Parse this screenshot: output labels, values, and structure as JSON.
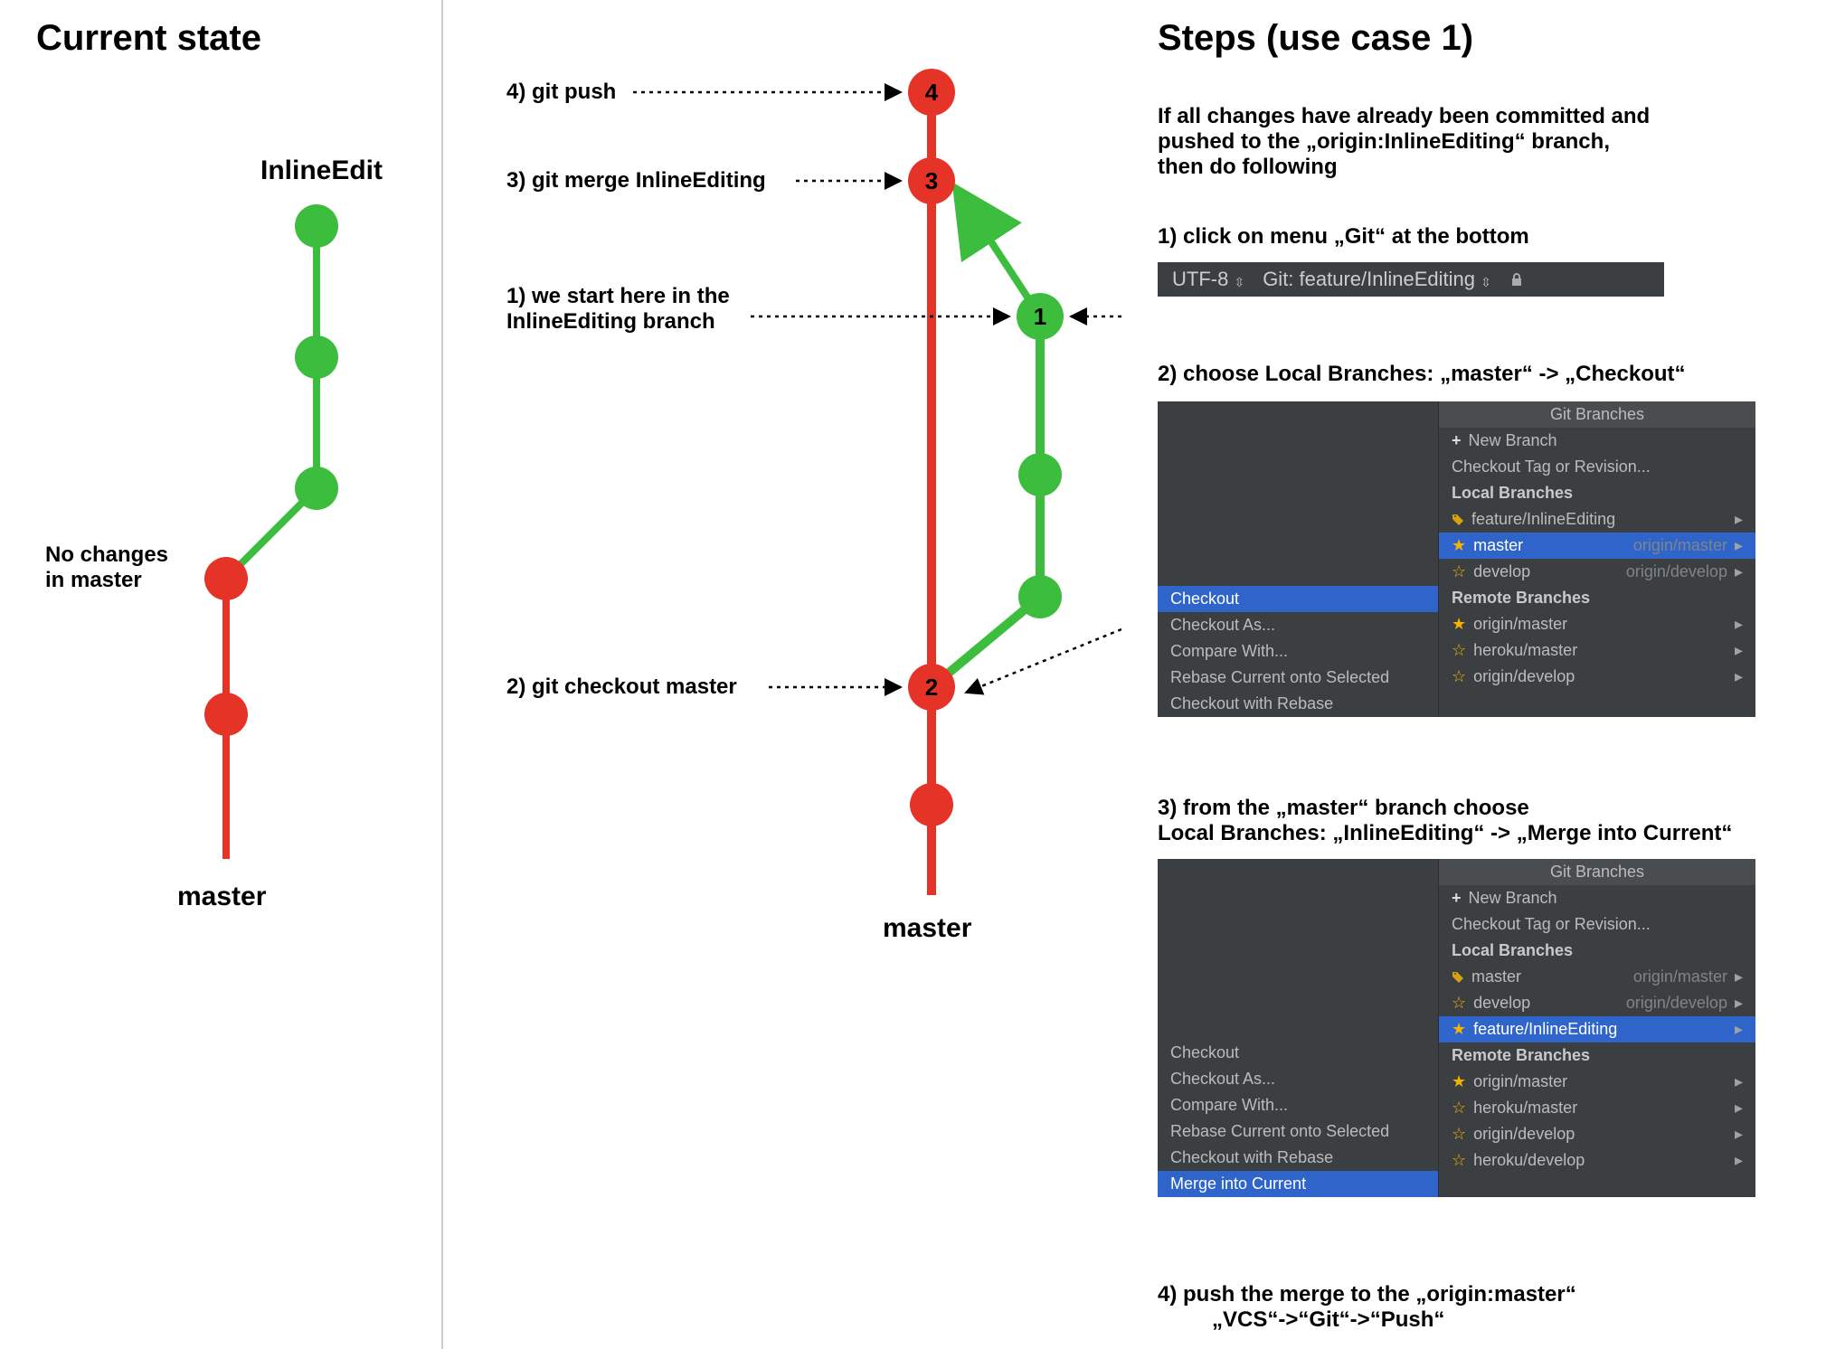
{
  "colors": {
    "red": "#e53427",
    "green": "#3dbd3d",
    "panel": "#3c3f41",
    "sel": "#2f65ca"
  },
  "left": {
    "title": "Current state",
    "feature_label": "InlineEdit",
    "no_changes_l1": "No changes",
    "no_changes_l2": "in master",
    "master_label": "master"
  },
  "mid": {
    "step4": "4) git push",
    "step3": "3) git merge InlineEditing",
    "step1_l1": "1) we start here in the",
    "step1_l2": "InlineEditing branch",
    "step2": "2) git checkout master",
    "master_label": "master",
    "commit4": "4",
    "commit3": "3",
    "commit2": "2",
    "commit1": "1"
  },
  "right": {
    "title": "Steps (use case 1)",
    "intro_l1": "If all changes have already been committed and",
    "intro_l2": "pushed to the „origin:InlineEditing“ branch,",
    "intro_l3": "then do following",
    "step1": "1) click on menu „Git“ at the bottom",
    "status_encoding": "UTF-8",
    "status_branch": "Git: feature/InlineEditing",
    "step2": "2) choose Local Branches: „master“ -> „Checkout“",
    "step3_l1": "3) from the „master“ branch choose",
    "step3_l2": "Local Branches: „InlineEditing“ -> „Merge into Current“",
    "step4_l1": "4) push the merge to the „origin:master“",
    "step4_l2": "„VCS“->“Git“->“Push“"
  },
  "popup_common": {
    "header": "Git Branches",
    "new_branch": "New Branch",
    "checkout_tag": "Checkout Tag or Revision...",
    "local": "Local Branches",
    "remote": "Remote Branches"
  },
  "popupA": {
    "local": [
      {
        "name": "feature/InlineEditing",
        "tracking": "",
        "tag": true,
        "star": false,
        "sel": false
      },
      {
        "name": "master",
        "tracking": "origin/master",
        "tag": false,
        "star": true,
        "sel": true
      },
      {
        "name": "develop",
        "tracking": "origin/develop",
        "tag": false,
        "star": false,
        "sel": false
      }
    ],
    "remote": [
      {
        "name": "origin/master",
        "star": true
      },
      {
        "name": "heroku/master",
        "star": false
      },
      {
        "name": "origin/develop",
        "star": false
      }
    ],
    "actions": [
      "Checkout",
      "Checkout As...",
      "Compare With...",
      "Rebase Current onto Selected",
      "Checkout with Rebase"
    ],
    "selected_action_index": 0
  },
  "popupB": {
    "local": [
      {
        "name": "master",
        "tracking": "origin/master",
        "tag": true,
        "star": false,
        "sel": false
      },
      {
        "name": "develop",
        "tracking": "origin/develop",
        "tag": false,
        "star": false,
        "sel": false
      },
      {
        "name": "feature/InlineEditing",
        "tracking": "",
        "tag": false,
        "star": true,
        "sel": true
      }
    ],
    "remote": [
      {
        "name": "origin/master",
        "star": true
      },
      {
        "name": "heroku/master",
        "star": false
      },
      {
        "name": "origin/develop",
        "star": false
      },
      {
        "name": "heroku/develop",
        "star": false
      }
    ],
    "actions": [
      "Checkout",
      "Checkout As...",
      "Compare With...",
      "Rebase Current onto Selected",
      "Checkout with Rebase",
      "Merge into Current"
    ],
    "selected_action_index": 5
  },
  "chart_data": {
    "type": "diagram",
    "title": "Git branch merge walkthrough (feature/InlineEditing → master)",
    "current_state": {
      "branches": [
        {
          "name": "master",
          "color": "#e53427",
          "commits": 3
        },
        {
          "name": "InlineEdit",
          "color": "#3dbd3d",
          "commits": 3,
          "forks_from": "master"
        }
      ],
      "note": "No changes in master"
    },
    "target_state": {
      "master_commits": [
        {
          "id": 2,
          "label": "git checkout master"
        },
        {
          "id": 3,
          "label": "git merge InlineEditing"
        },
        {
          "id": 4,
          "label": "git push"
        }
      ],
      "feature_head": {
        "id": 1,
        "label": "we start here in the InlineEditing branch"
      },
      "merge": {
        "from": "feature/InlineEditing(1)",
        "into": "master(3)"
      }
    }
  }
}
